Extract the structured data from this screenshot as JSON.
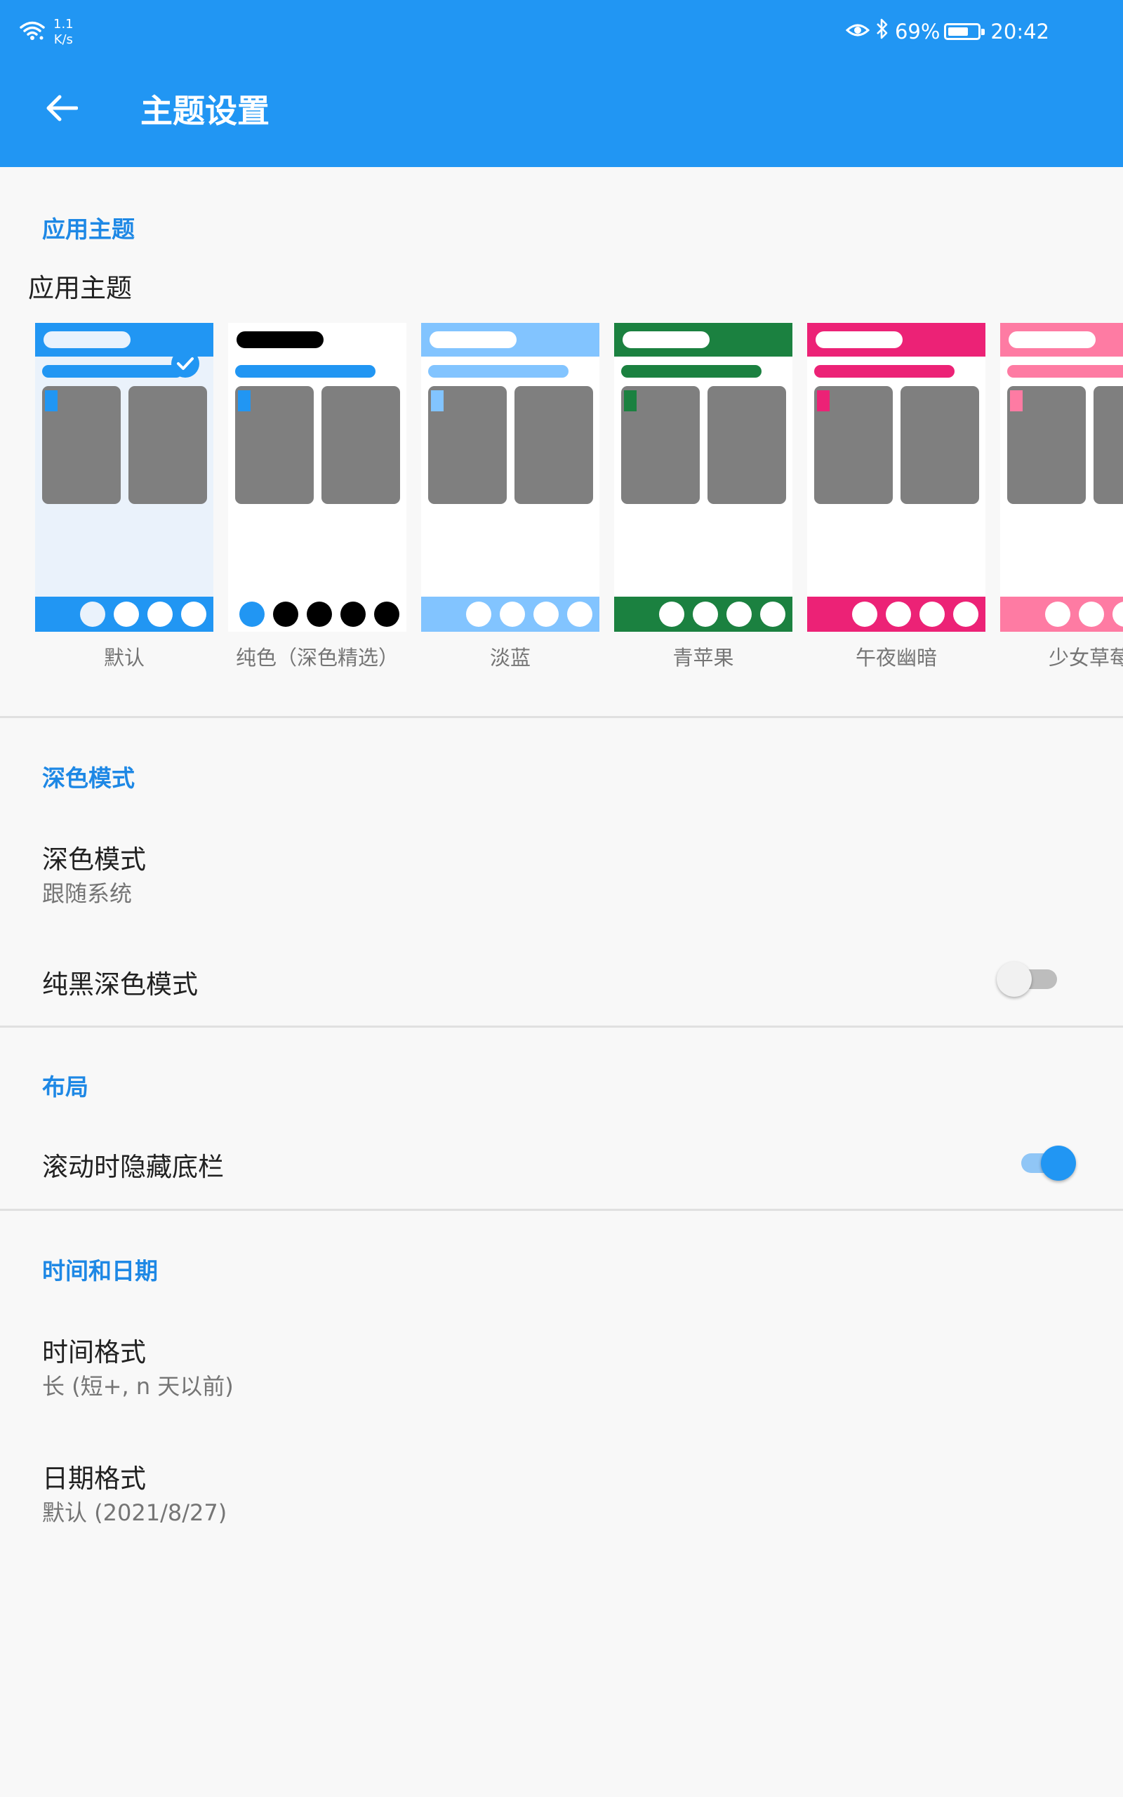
{
  "status_bar": {
    "net_speed_value": "1.1",
    "net_speed_unit": "K/s",
    "battery_percent": "69%",
    "battery_level": 0.69,
    "time": "20:42",
    "icons": [
      "wifi-icon",
      "eye-icon",
      "bluetooth-icon",
      "battery-charging-icon"
    ]
  },
  "app_bar": {
    "title": "主题设置",
    "back_icon": "arrow-back-icon",
    "color": "#2196f3"
  },
  "app_theme": {
    "section_header": "应用主题",
    "title": "应用主题",
    "selected_index": 0,
    "themes": [
      {
        "label": "默认",
        "accent": "#2196f3",
        "bar": "#2196f3",
        "pill": "#e8f2fd",
        "dots": [
          "#eaf2fb",
          "#ffffff",
          "#ffffff",
          "#ffffff"
        ],
        "dot_bg": "#2196f3"
      },
      {
        "label": "纯色（深色精选）",
        "accent": "#2196f3",
        "bar": "#ffffff",
        "pill": "#000000",
        "dots": [
          "#2196f3",
          "#000000",
          "#000000",
          "#000000",
          "#000000"
        ],
        "dot_bg": "#ffffff"
      },
      {
        "label": "淡蓝",
        "accent": "#82c4ff",
        "bar": "#82c4ff",
        "pill": "#ffffff",
        "dots": [
          "#ffffff",
          "#ffffff",
          "#ffffff",
          "#ffffff"
        ],
        "dot_bg": "#82c4ff"
      },
      {
        "label": "青苹果",
        "accent": "#1b8140",
        "bar": "#1b8140",
        "pill": "#ffffff",
        "dots": [
          "#ffffff",
          "#ffffff",
          "#ffffff",
          "#ffffff"
        ],
        "dot_bg": "#1b8140"
      },
      {
        "label": "午夜幽暗",
        "accent": "#ec2276",
        "bar": "#ec2276",
        "pill": "#ffffff",
        "dots": [
          "#ffffff",
          "#ffffff",
          "#ffffff",
          "#ffffff"
        ],
        "dot_bg": "#ec2276"
      },
      {
        "label": "少女草莓",
        "accent": "#fe7ba3",
        "bar": "#fe7ba3",
        "pill": "#ffffff",
        "dots": [
          "#ffffff",
          "#ffffff",
          "#ffffff",
          "#ffffff"
        ],
        "dot_bg": "#fe7ba3"
      }
    ]
  },
  "dark_mode": {
    "section_header": "深色模式",
    "mode_title": "深色模式",
    "mode_value": "跟随系统",
    "pure_black_title": "纯黑深色模式",
    "pure_black_enabled": false
  },
  "layout": {
    "section_header": "布局",
    "hide_bottom_bar_title": "滚动时隐藏底栏",
    "hide_bottom_bar_enabled": true
  },
  "time_date": {
    "section_header": "时间和日期",
    "time_format_title": "时间格式",
    "time_format_value": "长 (短+, n 天以前)",
    "date_format_title": "日期格式",
    "date_format_value": "默认 (2021/8/27)"
  }
}
